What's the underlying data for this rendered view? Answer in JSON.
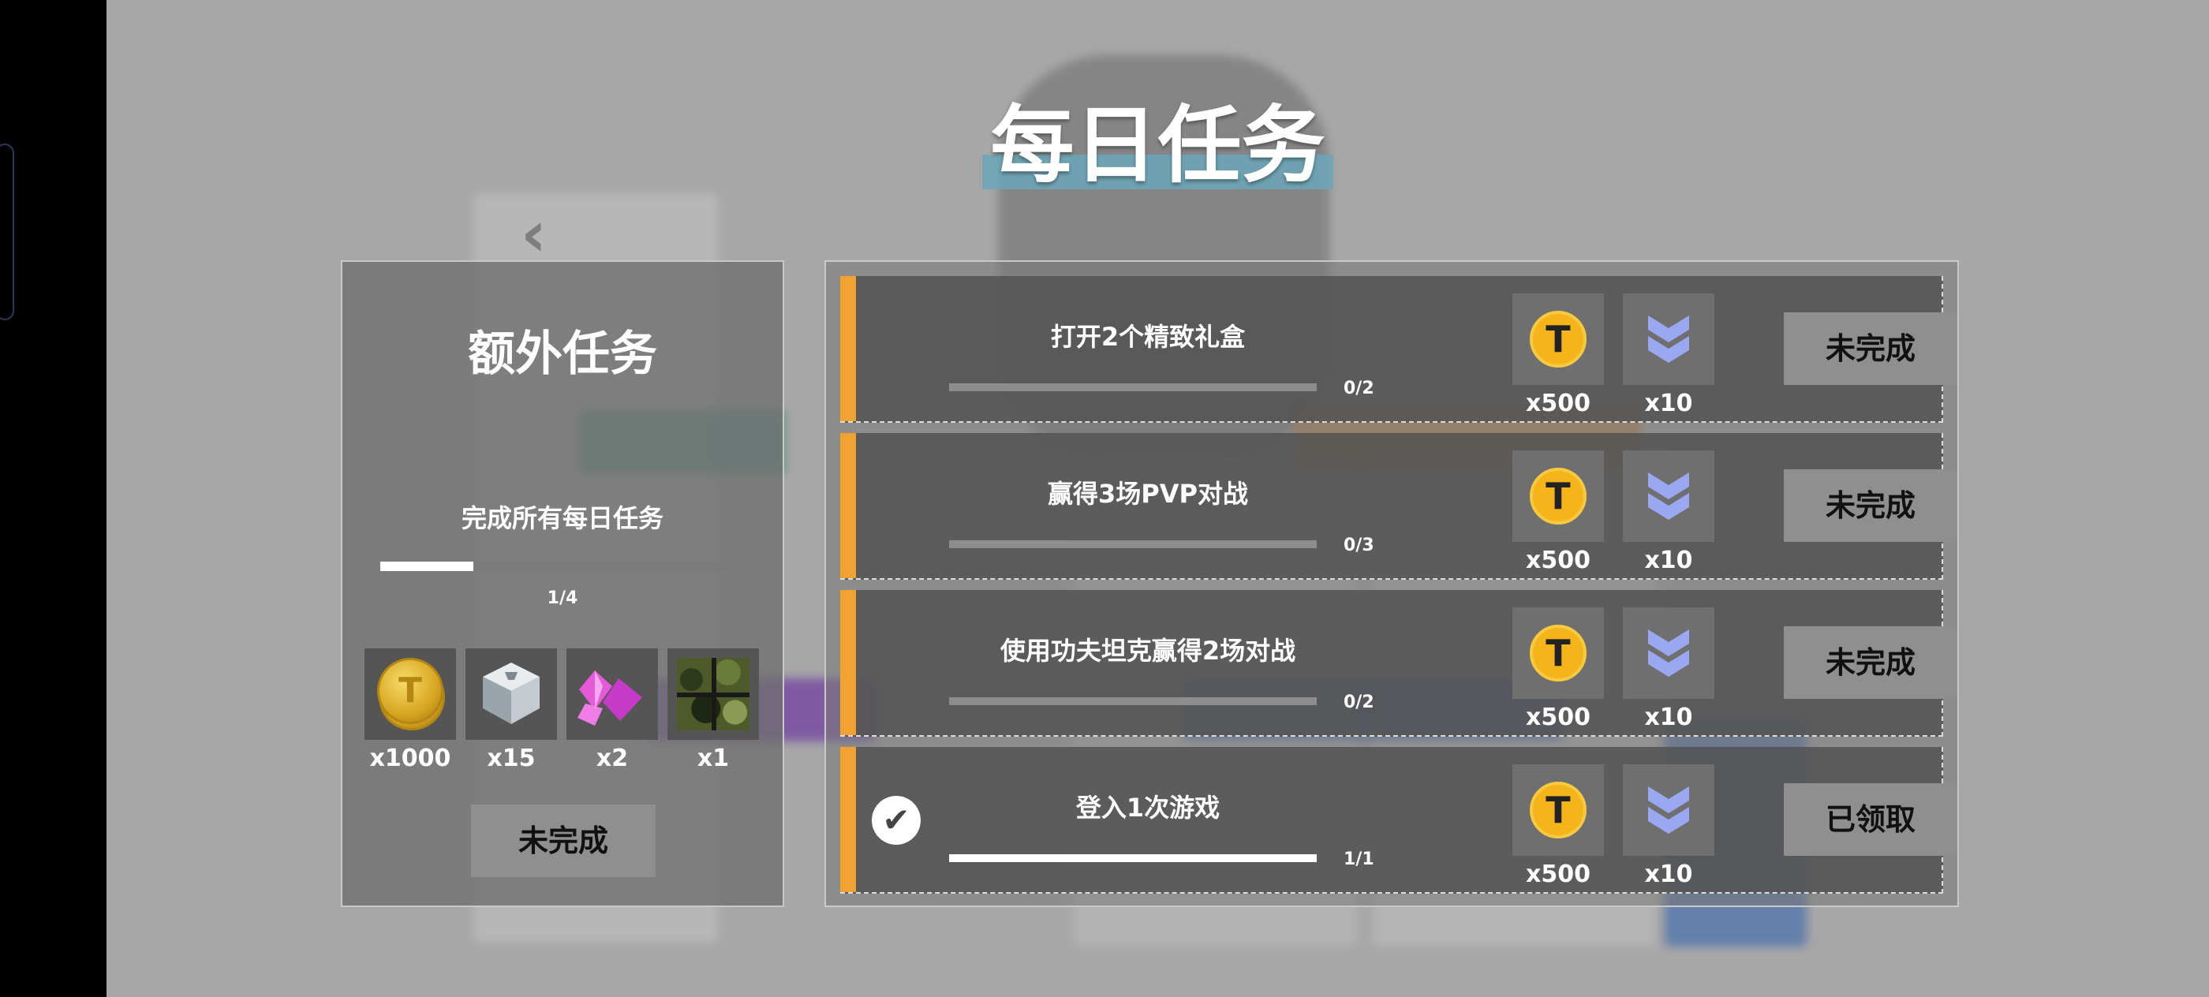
{
  "header": {
    "title": "每日任务"
  },
  "extra": {
    "title": "额外任务",
    "description": "完成所有每日任务",
    "progress_text": "1/4",
    "progress_fraction": 0.25,
    "rewards": [
      {
        "icon": "gold-coins-icon",
        "qty": "x1000"
      },
      {
        "icon": "silver-cube-icon",
        "qty": "x15"
      },
      {
        "icon": "pink-crystal-icon",
        "qty": "x2"
      },
      {
        "icon": "camo-pattern-icon",
        "qty": "x1"
      }
    ],
    "button_label": "未完成"
  },
  "tasks": [
    {
      "name": "打开2个精致礼盒",
      "progress_text": "0/2",
      "progress_fraction": 0,
      "completed": false,
      "reward_coin_qty": "x500",
      "reward_rank_qty": "x10",
      "status_label": "未完成"
    },
    {
      "name": "赢得3场PVP对战",
      "progress_text": "0/3",
      "progress_fraction": 0,
      "completed": false,
      "reward_coin_qty": "x500",
      "reward_rank_qty": "x10",
      "status_label": "未完成"
    },
    {
      "name": "使用功夫坦克赢得2场对战",
      "progress_text": "0/2",
      "progress_fraction": 0,
      "completed": false,
      "reward_coin_qty": "x500",
      "reward_rank_qty": "x10",
      "status_label": "未完成"
    },
    {
      "name": "登入1次游戏",
      "progress_text": "1/1",
      "progress_fraction": 1,
      "completed": true,
      "reward_coin_qty": "x500",
      "reward_rank_qty": "x10",
      "status_label": "已领取"
    }
  ],
  "icons": {
    "coin_letter": "T",
    "check_glyph": "✔",
    "back_glyph": "‹"
  },
  "colors": {
    "accent_orange": "#f2a231",
    "coin_yellow": "#f4b41a",
    "rank_chevron": "#9aa8f2",
    "title_underline": "#6aa6b8"
  }
}
